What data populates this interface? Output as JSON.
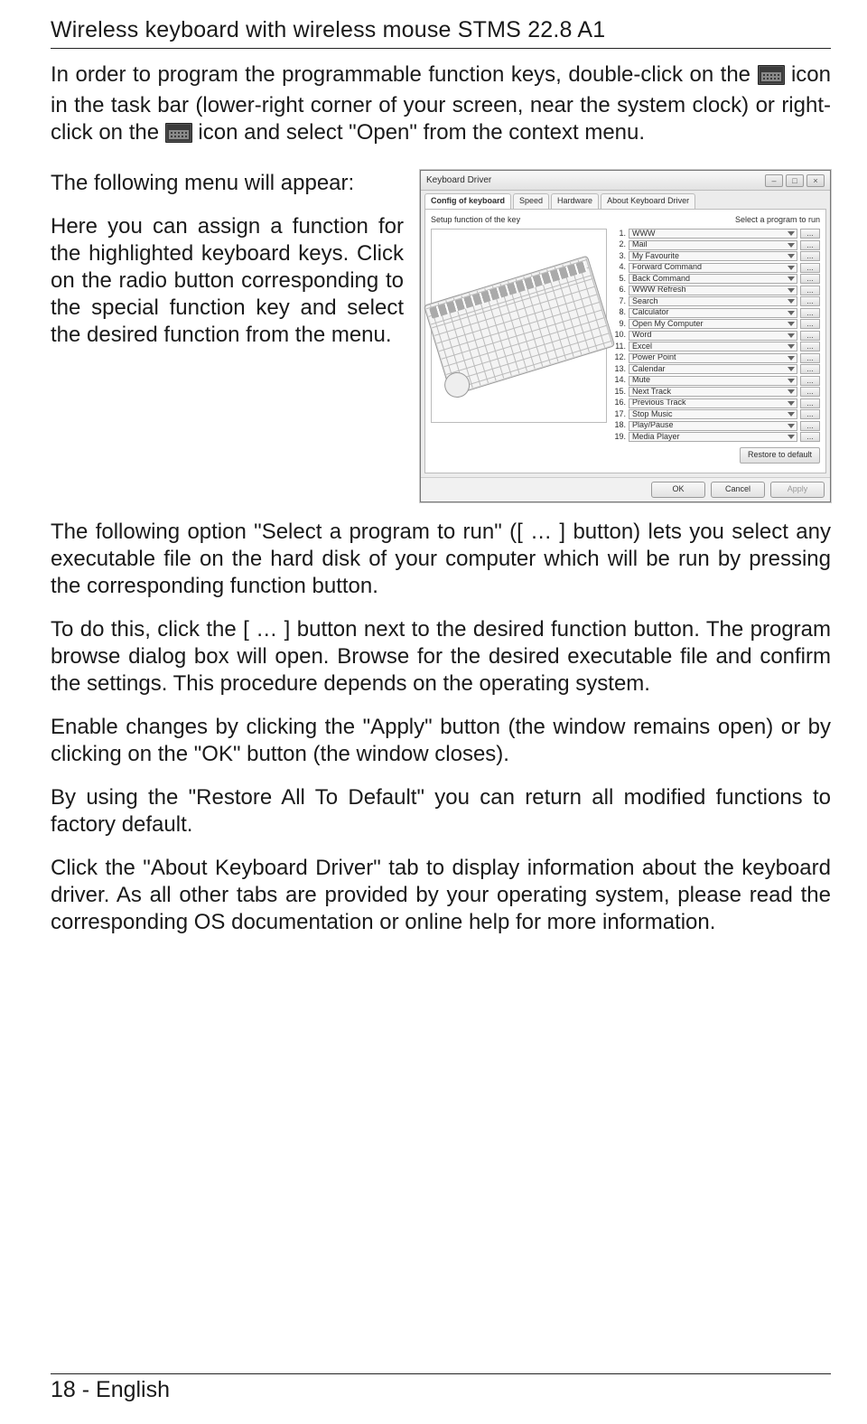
{
  "header": "Wireless keyboard with wireless mouse STMS 22.8 A1",
  "p1a": "In order to program the programmable function keys, double-click on the ",
  "p1b": " icon in the task bar (lower-right corner of your screen, near the system clock) or right-click on the ",
  "p1c": " icon and select \"Open\" from the context menu.",
  "p2": "The following menu will appear:",
  "p3": "Here you can assign a function for the highlighted keyboard keys. Click on the radio button corresponding to the special function key and select the desired function from the menu.",
  "p4": "The following option \"Select a program to run\" ([ … ] button) lets you select any executable file on the hard disk of your computer which will be run by pressing the corresponding function button.",
  "p5": "To do this, click the [ … ] button next to the desired function button. The program browse dialog box will open. Browse for the desired executable file and confirm the settings. This procedure depends on the operating system.",
  "p6": "Enable changes by clicking the \"Apply\" button (the window remains open) or by clicking on the \"OK\" button (the window closes).",
  "p7": "By using the \"Restore All To Default\" you can return all modified functions to factory default.",
  "p8": "Click the \"About Keyboard Driver\" tab to display information about the keyboard driver. As all other tabs are provided by your operating system, please read the corresponding OS documentation or online help for more information.",
  "footer": "18  -  English",
  "window": {
    "title": "Keyboard Driver",
    "tabs": [
      "Config of keyboard",
      "Speed",
      "Hardware",
      "About Keyboard Driver"
    ],
    "setup_label": "Setup function of the key",
    "program_label": "Select a program to run",
    "items": [
      {
        "n": "1.",
        "label": "WWW"
      },
      {
        "n": "2.",
        "label": "Mail"
      },
      {
        "n": "3.",
        "label": "My Favourite"
      },
      {
        "n": "4.",
        "label": "Forward Command"
      },
      {
        "n": "5.",
        "label": "Back Command"
      },
      {
        "n": "6.",
        "label": "WWW Refresh"
      },
      {
        "n": "7.",
        "label": "Search"
      },
      {
        "n": "8.",
        "label": "Calculator"
      },
      {
        "n": "9.",
        "label": "Open My Computer"
      },
      {
        "n": "10.",
        "label": "Word"
      },
      {
        "n": "11.",
        "label": "Excel"
      },
      {
        "n": "12.",
        "label": "Power Point"
      },
      {
        "n": "13.",
        "label": "Calendar"
      },
      {
        "n": "14.",
        "label": "Mute"
      },
      {
        "n": "15.",
        "label": "Next Track"
      },
      {
        "n": "16.",
        "label": "Previous Track"
      },
      {
        "n": "17.",
        "label": "Stop Music"
      },
      {
        "n": "18.",
        "label": "Play/Pause"
      },
      {
        "n": "19.",
        "label": "Media Player"
      }
    ],
    "restore": "Restore to default",
    "ok": "OK",
    "cancel": "Cancel",
    "apply": "Apply",
    "dots": "…"
  }
}
